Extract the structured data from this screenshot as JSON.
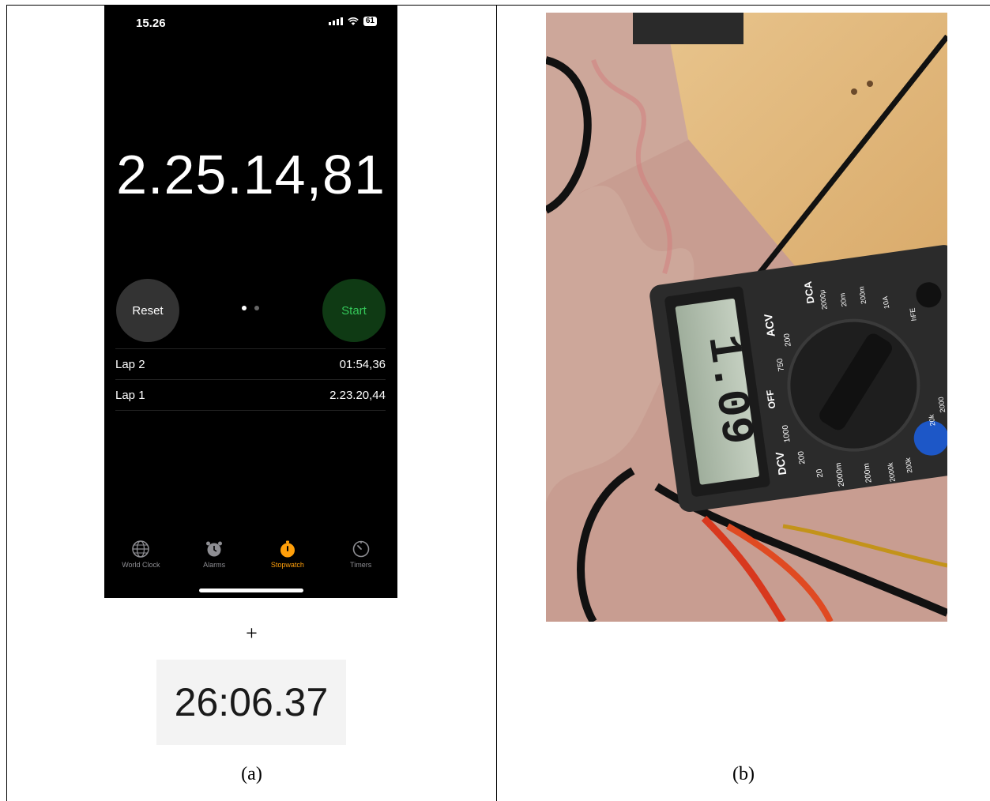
{
  "phone": {
    "status_time": "15.26",
    "battery": "61",
    "elapsed": "2.25.14,81",
    "reset_label": "Reset",
    "start_label": "Start",
    "laps": [
      {
        "label": "Lap 2",
        "time": "01:54,36"
      },
      {
        "label": "Lap 1",
        "time": "2.23.20,44"
      }
    ],
    "tabs": [
      {
        "label": "World Clock",
        "icon": "globe-icon"
      },
      {
        "label": "Alarms",
        "icon": "alarm-clock-icon"
      },
      {
        "label": "Stopwatch",
        "icon": "stopwatch-icon"
      },
      {
        "label": "Timers",
        "icon": "timer-icon"
      }
    ],
    "accent": "#ff9f0a",
    "start_color": "#34c759"
  },
  "plus": "+",
  "digital_readout": "26:06.37",
  "caption_a": "(a)",
  "caption_b": "(b)",
  "multimeter": {
    "display": "1.09",
    "labels": [
      "ACV",
      "DCA",
      "DCV",
      "OFF",
      "750",
      "200",
      "1000",
      "200",
      "20",
      "2000m",
      "200m",
      "2000μ",
      "20m",
      "200m",
      "10A",
      "hFE",
      "2000k",
      "200k",
      "20k",
      "2000",
      "200"
    ]
  }
}
